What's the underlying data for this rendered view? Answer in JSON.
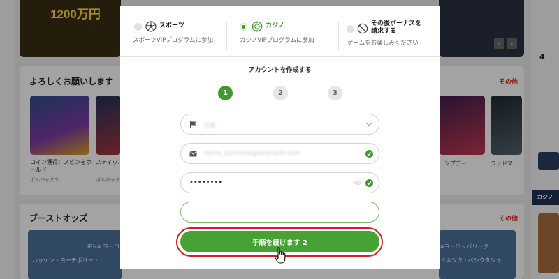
{
  "background": {
    "hero_amount": "1200万円",
    "section1_title": "よろしくお願いします",
    "more_label": "その他",
    "games": [
      {
        "title": "コイン獲得：スピンをホールド",
        "provider": "ボルジャクス"
      },
      {
        "title": "スティッ…：スピ",
        "provider": "ボルジャクス"
      },
      {
        "title": "…ンプデー",
        "provider": ""
      },
      {
        "title": "ラッドマ",
        "provider": ""
      }
    ],
    "section2_title": "ブーストオッズ",
    "odds_left": "ハッケン・ヨーテボリー・",
    "odds_left_tag": "IRNA ヨーロッパリーグ",
    "odds_right_tag": "Aヨーロッパリーグ",
    "odds_right": "ドネツク・ベシクタシュ",
    "right_num": "4",
    "right_tab": "カジノ",
    "arrows": [
      "‹",
      "›"
    ]
  },
  "modal": {
    "bonus_options": [
      {
        "title": "スポーツ",
        "description": "スポーツVIPプログラムに参加",
        "selected": false,
        "icon": "soccer-ball-icon"
      },
      {
        "title": "カジノ",
        "description": "カジノVIPプログラムに参加",
        "selected": true,
        "icon": "casino-chip-icon"
      },
      {
        "title": "その後ボーナスを請求する",
        "title_line1": "その後ボーナスを",
        "title_line2": "請求する",
        "description": "ゲームをお楽しみください",
        "selected": false,
        "icon": "no-symbol-icon"
      }
    ],
    "create_account_title": "アカウントを作成する",
    "steps": [
      "1",
      "2",
      "3"
    ],
    "current_step": 1,
    "fields": {
      "country_value": "日本",
      "email_value": "name_surname@example.com",
      "password_value": "••••••••",
      "empty_field_value": ""
    },
    "cta_label": "手順を続けます 2"
  },
  "colors": {
    "accent_green": "#46a232",
    "highlight_red": "#d51f1f"
  }
}
